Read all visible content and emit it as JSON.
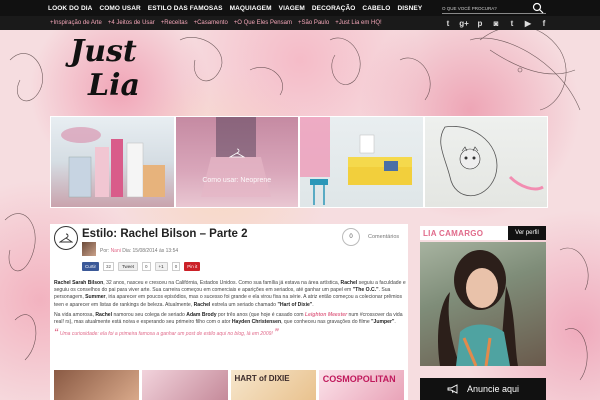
{
  "brand": {
    "logo_line1": "Just",
    "logo_line2": "Lia"
  },
  "topnav": {
    "items": [
      "LOOK DO DIA",
      "COMO USAR",
      "ESTILO DAS FAMOSAS",
      "MAQUIAGEM",
      "VIAGEM",
      "DECORAÇÃO",
      "CABELO",
      "DISNEY"
    ],
    "search_placeholder": "O QUE VOCÊ PROCURA?"
  },
  "subnav": {
    "items": [
      "+Inspiração de Arte",
      "+4 Jeitos de Usar",
      "+Receitas",
      "+Casamento",
      "+O Que Eles Pensam",
      "+São Paulo",
      "+Just Lia em HQ!"
    ],
    "social_icons": [
      "twitter-icon",
      "google-plus-icon",
      "pinterest-icon",
      "instagram-icon",
      "tumblr-icon",
      "youtube-icon",
      "facebook-icon"
    ]
  },
  "slider": {
    "slides": [
      {
        "name": "perfumes",
        "caption": ""
      },
      {
        "name": "neoprene-skirt",
        "caption": "Como usar: Neoprene"
      },
      {
        "name": "yellow-sofa",
        "caption": ""
      },
      {
        "name": "cat-illustration",
        "caption": ""
      }
    ]
  },
  "post": {
    "title": "Estilo: Rachel Bilson – Parte 2",
    "comments_count": "0",
    "comments_label": "Comentários",
    "meta_prefix": "Por:",
    "author": "Nani",
    "meta_date": "Dia: 15/08/2014 às 13:54",
    "share": {
      "fb_label": "Curtir",
      "fb_count": "32",
      "tw_label": "Tweet",
      "tw_count": "0",
      "gp_label": "+1",
      "gp_count": "0",
      "pin_label": "Pin it"
    },
    "p1": {
      "a": "Rachel Sarah Bilson",
      "b": ", 32 anos, nasceu e cresceu na Califórnia, Estados Unidos. Como sua família já estava na área artística, ",
      "c": "Rachel",
      "d": " seguiu a faculdade e seguiu os conselhos do pai para viver arte. Sua carreira começou em comerciais e aparições em seriados, até ganhar um papel em ",
      "e": "\"The O.C.\"",
      "f": ". Sua personagem, ",
      "g": "Summer",
      "h": ", iria aparecer em poucos episódios, mas o sucesso foi grande e ela virou fixa na série. A atriz então começou a colecionar prêmios teen e aparecer em listas de rankings de beleza. Atualmente, ",
      "i": "Rachel",
      "j": " estrela um seriado chamado ",
      "k": "\"Hart of Dixie\"",
      "l": "."
    },
    "p2": {
      "a": "Na vida amorosa, ",
      "b": "Rachel",
      "c": " namorou seu colega de seriado ",
      "d": "Adam Brody",
      "e": " por três anos (que hoje é casado com ",
      "f": "Leighton Meester",
      "g": " num #crossover da vida real! rs), mas atualmente está noiva e esperando seu primeiro filho com o ator ",
      "h": "Hayden Christensen",
      "i": ", que conheceu nas gravações do filme ",
      "j": "\"Jumper\"",
      "k": "."
    },
    "quote": "Uma curiosidade: ela foi a primeira famosa a ganhar um post de estilo aqui no blog, lá em 2009!",
    "thumbs": [
      {
        "name": "couple-photo",
        "label": ""
      },
      {
        "name": "magazine-cover",
        "label": ""
      },
      {
        "name": "hart-of-dixie",
        "label": "HART of DIXIE"
      },
      {
        "name": "cosmopolitan",
        "label": "COSMOPOLITAN"
      }
    ]
  },
  "sidebar": {
    "name": "LIA CAMARGO",
    "profile_button": "Ver perfil",
    "ad_label": "Anuncie aqui"
  },
  "colors": {
    "accent": "#e06a8a",
    "nav_bg": "#111111",
    "subnav_text": "#f3a6b8"
  }
}
